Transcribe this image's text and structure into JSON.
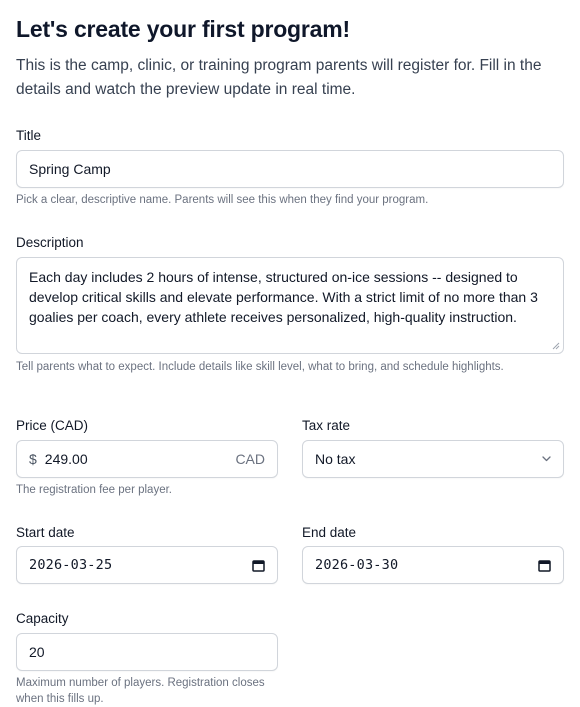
{
  "header": {
    "title": "Let's create your first program!",
    "intro": "This is the camp, clinic, or training program parents will register for. Fill in the details and watch the preview update in real time."
  },
  "fields": {
    "title": {
      "label": "Title",
      "value": "Spring Camp",
      "help": "Pick a clear, descriptive name. Parents will see this when they find your program."
    },
    "description": {
      "label": "Description",
      "value": "Each day includes 2 hours of intense, structured on-ice sessions -- designed to develop critical skills and elevate performance. With a strict limit of no more than 3 goalies per coach, every athlete receives personalized, high-quality instruction.",
      "help": "Tell parents what to expect. Include details like skill level, what to bring, and schedule highlights."
    },
    "price": {
      "label": "Price (CAD)",
      "prefix": "$",
      "value": "249.00",
      "suffix": "CAD",
      "help": "The registration fee per player."
    },
    "tax_rate": {
      "label": "Tax rate",
      "selected": "No tax"
    },
    "start_date": {
      "label": "Start date",
      "value": "2026-03-25"
    },
    "end_date": {
      "label": "End date",
      "value": "2026-03-30"
    },
    "capacity": {
      "label": "Capacity",
      "value": "20",
      "help": "Maximum number of players. Registration closes when this fills up."
    }
  },
  "icons": {
    "select_chevron": "chevron-down-icon",
    "date_picker": "calendar-icon",
    "resize_handle": "resize-handle-icon"
  },
  "colors": {
    "border": "#d1d5db",
    "help_text": "#6b7280",
    "heading": "#0f172a"
  }
}
